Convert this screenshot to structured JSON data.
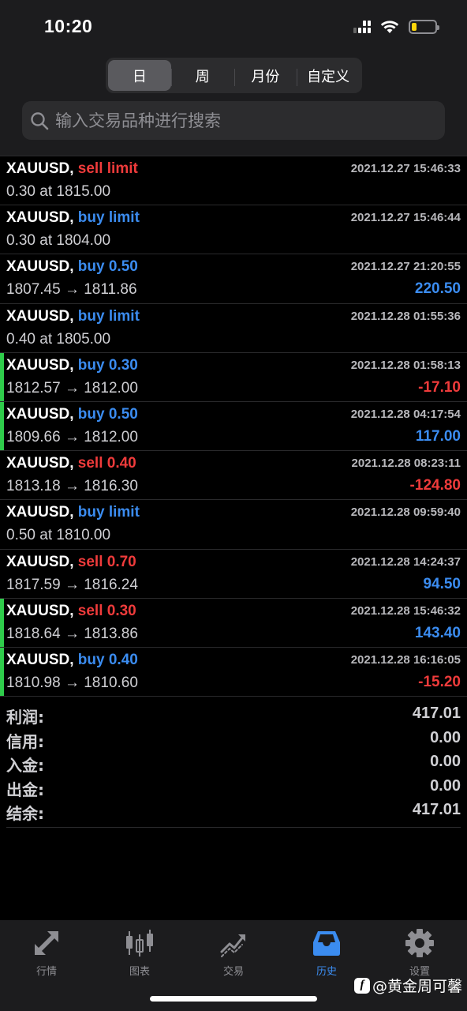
{
  "status_bar": {
    "time": "10:20"
  },
  "period_tabs": [
    {
      "label": "日",
      "active": true
    },
    {
      "label": "周",
      "active": false
    },
    {
      "label": "月份",
      "active": false
    },
    {
      "label": "自定义",
      "active": false
    }
  ],
  "search": {
    "placeholder": "输入交易品种进行搜索",
    "value": ""
  },
  "orders": [
    {
      "symbol": "XAUUSD,",
      "side": "sell limit",
      "side_type": "sell",
      "time": "2021.12.27 15:46:33",
      "price": "0.30 at 1815.00",
      "profit": "",
      "profit_sign": "",
      "bar": false
    },
    {
      "symbol": "XAUUSD,",
      "side": "buy limit",
      "side_type": "buy",
      "time": "2021.12.27 15:46:44",
      "price": "0.30 at 1804.00",
      "profit": "",
      "profit_sign": "",
      "bar": false
    },
    {
      "symbol": "XAUUSD,",
      "side": "buy 0.50",
      "side_type": "buy",
      "time": "2021.12.27 21:20:55",
      "price": "1807.45 → 1811.86",
      "profit": "220.50",
      "profit_sign": "pos",
      "bar": false
    },
    {
      "symbol": "XAUUSD,",
      "side": "buy limit",
      "side_type": "buy",
      "time": "2021.12.28 01:55:36",
      "price": "0.40 at 1805.00",
      "profit": "",
      "profit_sign": "",
      "bar": false
    },
    {
      "symbol": "XAUUSD,",
      "side": "buy 0.30",
      "side_type": "buy",
      "time": "2021.12.28 01:58:13",
      "price": "1812.57 → 1812.00",
      "profit": "-17.10",
      "profit_sign": "neg",
      "bar": true
    },
    {
      "symbol": "XAUUSD,",
      "side": "buy 0.50",
      "side_type": "buy",
      "time": "2021.12.28 04:17:54",
      "price": "1809.66 → 1812.00",
      "profit": "117.00",
      "profit_sign": "pos",
      "bar": true
    },
    {
      "symbol": "XAUUSD,",
      "side": "sell 0.40",
      "side_type": "sell",
      "time": "2021.12.28 08:23:11",
      "price": "1813.18 → 1816.30",
      "profit": "-124.80",
      "profit_sign": "neg",
      "bar": false
    },
    {
      "symbol": "XAUUSD,",
      "side": "buy limit",
      "side_type": "buy",
      "time": "2021.12.28 09:59:40",
      "price": "0.50 at 1810.00",
      "profit": "",
      "profit_sign": "",
      "bar": false
    },
    {
      "symbol": "XAUUSD,",
      "side": "sell 0.70",
      "side_type": "sell",
      "time": "2021.12.28 14:24:37",
      "price": "1817.59 → 1816.24",
      "profit": "94.50",
      "profit_sign": "pos",
      "bar": false
    },
    {
      "symbol": "XAUUSD,",
      "side": "sell 0.30",
      "side_type": "sell",
      "time": "2021.12.28 15:46:32",
      "price": "1818.64 → 1813.86",
      "profit": "143.40",
      "profit_sign": "pos",
      "bar": true
    },
    {
      "symbol": "XAUUSD,",
      "side": "buy 0.40",
      "side_type": "buy",
      "time": "2021.12.28 16:16:05",
      "price": "1810.98 → 1810.60",
      "profit": "-15.20",
      "profit_sign": "neg",
      "bar": true
    }
  ],
  "summary": [
    {
      "label": "利润:",
      "value": "417.01"
    },
    {
      "label": "信用:",
      "value": "0.00"
    },
    {
      "label": "入金:",
      "value": "0.00"
    },
    {
      "label": "出金:",
      "value": "0.00"
    },
    {
      "label": "结余:",
      "value": "417.01"
    }
  ],
  "tabbar": [
    {
      "label": "行情",
      "icon": "quotes-arrows-icon",
      "active": false
    },
    {
      "label": "图表",
      "icon": "candlestick-chart-icon",
      "active": false
    },
    {
      "label": "交易",
      "icon": "trade-trend-icon",
      "active": false
    },
    {
      "label": "历史",
      "icon": "history-inbox-icon",
      "active": true
    },
    {
      "label": "设置",
      "icon": "gear-icon",
      "active": false
    }
  ],
  "watermark": {
    "text": "@黄金周可馨"
  },
  "colors": {
    "buy": "#3b8cf0",
    "sell": "#ef3b3b",
    "active_bar": "#2fcc4b",
    "background": "#000000"
  }
}
